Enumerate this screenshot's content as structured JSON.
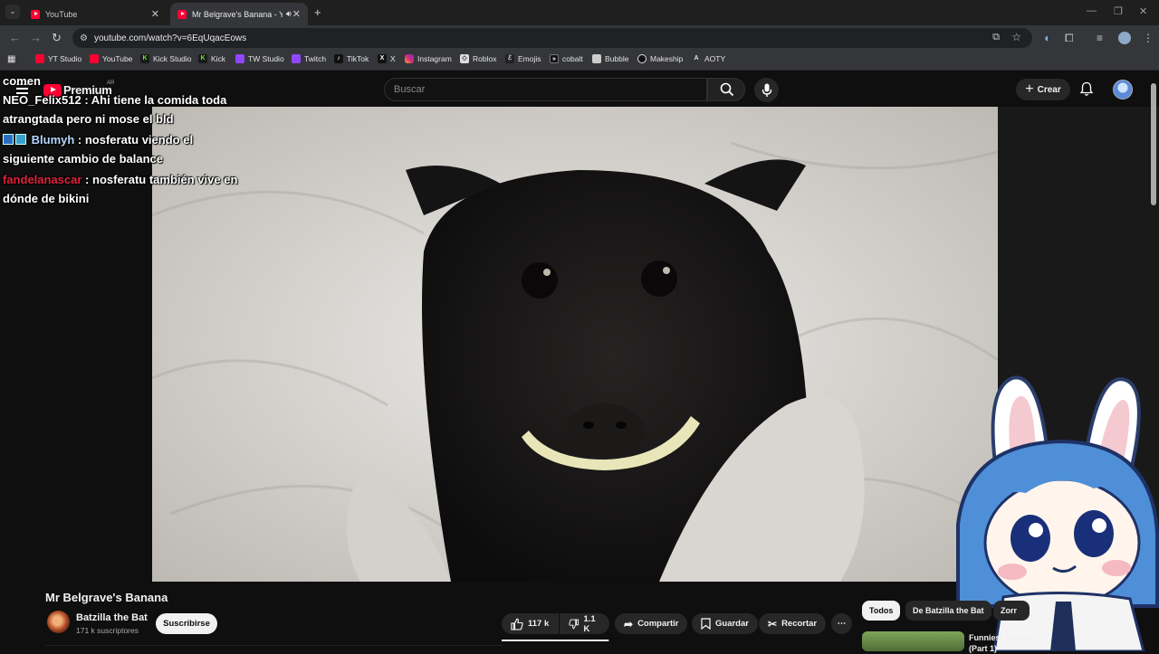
{
  "browser": {
    "tabs": [
      {
        "title": "YouTube",
        "active": false
      },
      {
        "title": "Mr Belgrave's Banana - You",
        "active": true
      }
    ],
    "url": "youtube.com/watch?v=6EqUqacEows",
    "bookmarks": [
      "YT Studio",
      "YouTube",
      "Kick Studio",
      "Kick",
      "TW Studio",
      "Twitch",
      "TikTok",
      "X",
      "Instagram",
      "Roblox",
      "Emojis",
      "cobalt",
      "Bubble",
      "Makeship",
      "AOTY"
    ]
  },
  "masthead": {
    "logo_word": "Premium",
    "country": "AR",
    "search_placeholder": "Buscar",
    "create_label": "Crear"
  },
  "chat": {
    "header": "comen",
    "messages": [
      {
        "user": "NEO_Felix512",
        "text": "Ahi tiene la comida toda atrangtada pero ni mose el bld"
      },
      {
        "user": "Blumyh",
        "text": "nosferatu viendo el siguiente cambio de balance"
      },
      {
        "user": "fandelanascar",
        "text": "nosferatu también vive en dónde de bikini"
      }
    ]
  },
  "video": {
    "title": "Mr Belgrave's Banana",
    "channel": "Batzilla the Bat",
    "subscribers": "171 k suscriptores",
    "subscribe_label": "Suscribirse",
    "likes": "117 k",
    "dislikes": "1.1 K",
    "share_label": "Compartir",
    "save_label": "Guardar",
    "clip_label": "Recortar",
    "like_ratio": 0.99
  },
  "recommendations": {
    "chips": [
      "Todos",
      "De Batzilla the Bat",
      "Zorr"
    ],
    "first_title": "Funniest Animal Vic",
    "first_subtitle": "(Part 1)"
  },
  "colors": {
    "yt_red": "#ff0033",
    "background": "#0f0f0f",
    "chip_bg": "#272727"
  }
}
